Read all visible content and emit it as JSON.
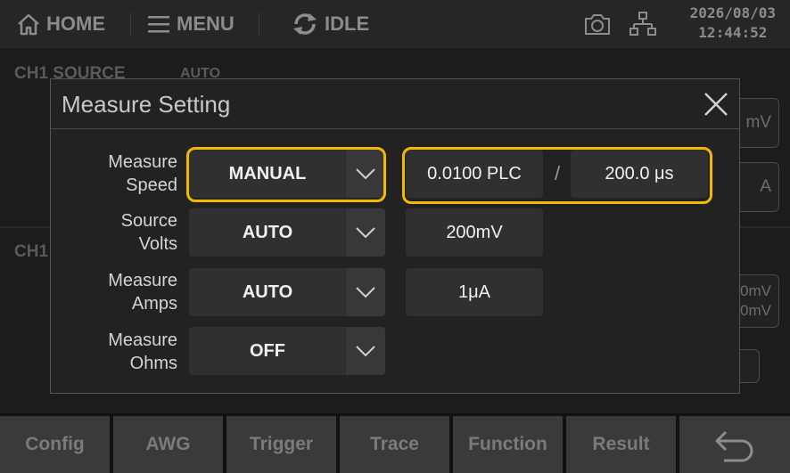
{
  "topbar": {
    "home_label": "HOME",
    "menu_label": "MENU",
    "status_label": "IDLE",
    "date": "2026/08/03",
    "time": "12:44:52"
  },
  "background": {
    "ch1_source_label": "CH1 SOURCE",
    "ch1_source_mode": "AUTO",
    "ch1_label": "CH1",
    "right_box_1": "mV",
    "right_box_2": "A",
    "right_box_3a": "0mV",
    "right_box_3b": "0mV"
  },
  "dialog": {
    "title": "Measure Setting",
    "rows": [
      {
        "label_line1": "Measure",
        "label_line2": "Speed",
        "select_value": "MANUAL",
        "value_1": "0.0100 PLC",
        "separator": "/",
        "value_2": "200.0 μs"
      },
      {
        "label_line1": "Source",
        "label_line2": "Volts",
        "select_value": "AUTO",
        "value_1": "200mV"
      },
      {
        "label_line1": "Measure",
        "label_line2": "Amps",
        "select_value": "AUTO",
        "value_1": "1μA"
      },
      {
        "label_line1": "Measure",
        "label_line2": "Ohms",
        "select_value": "OFF"
      }
    ]
  },
  "bottombar": {
    "buttons": [
      "Config",
      "AWG",
      "Trigger",
      "Trace",
      "Function",
      "Result"
    ]
  },
  "colors": {
    "highlight": "#f5b800",
    "dialog_bg": "#222222",
    "field_bg": "#303030"
  },
  "icons": {
    "home": "home-icon",
    "menu": "hamburger-menu-icon",
    "status": "refresh-cycle-icon",
    "camera": "camera-icon",
    "network": "network-icon",
    "close": "close-icon",
    "dropdown": "chevron-down-icon",
    "back": "back-arrow-icon"
  }
}
